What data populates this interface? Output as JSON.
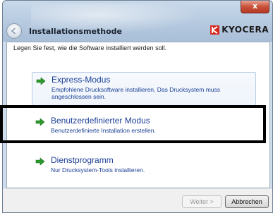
{
  "window": {
    "title": "Installationsmethode",
    "close_label": "x",
    "brand": "KYOCERA",
    "brand_color": "#d6281e"
  },
  "content": {
    "instruction": "Legen Sie fest, wie die Software installiert werden soll."
  },
  "options": [
    {
      "title": "Express-Modus",
      "description": "Empfohlene Drucksoftware installieren. Das Drucksystem muss angeschlossen sein.",
      "icon": "green-arrow-icon"
    },
    {
      "title": "Benutzerdefinierter Modus",
      "description": "Benutzerdefinierte Installation erstellen.",
      "icon": "green-arrow-icon"
    },
    {
      "title": "Dienstprogramm",
      "description": "Nur Drucksystem-Tools installieren.",
      "icon": "green-arrow-icon"
    }
  ],
  "footer": {
    "next_label": "Weiter >",
    "cancel_label": "Abbrechen"
  },
  "colors": {
    "link_text": "#1c3f95",
    "arrow": "#2e9a2e",
    "highlight_frame": "#000000"
  }
}
